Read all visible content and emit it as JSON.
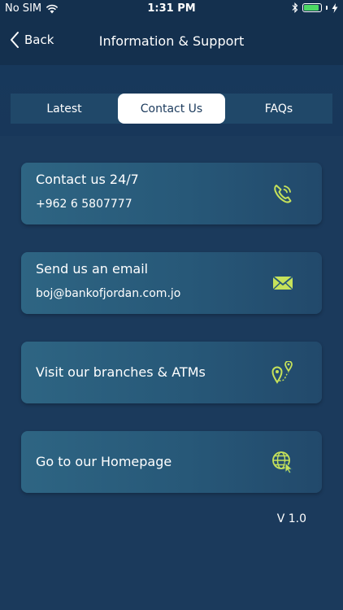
{
  "status": {
    "carrier": "No SIM",
    "time": "1:31 PM"
  },
  "nav": {
    "back_label": "Back",
    "title": "Information & Support"
  },
  "tabs": [
    {
      "label": "Latest",
      "active": false
    },
    {
      "label": "Contact Us",
      "active": true
    },
    {
      "label": "FAQs",
      "active": false
    }
  ],
  "cards": [
    {
      "title": "Contact us 24/7",
      "subtitle": "+962 6 5807777",
      "icon": "phone-icon"
    },
    {
      "title": "Send us an email",
      "subtitle": "boj@bankofjordan.com.jo",
      "icon": "envelope-icon"
    },
    {
      "title": "Visit our branches & ATMs",
      "icon": "location-pin-icon"
    },
    {
      "title": "Go to our Homepage",
      "icon": "globe-cursor-icon"
    }
  ],
  "version": "V 1.0",
  "colors": {
    "accent": "#c6e25a",
    "background": "#1b3a5c",
    "nav": "#14304e"
  }
}
